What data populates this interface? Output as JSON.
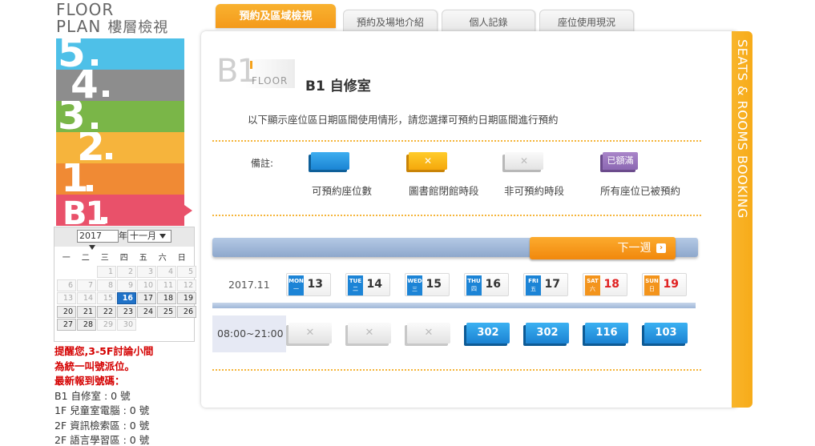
{
  "brand": {
    "line1": "FLOOR",
    "line2": "PLAN",
    "subtitle": "樓層檢視"
  },
  "floors": [
    "5",
    "4",
    "3",
    "2",
    "1",
    "B1"
  ],
  "colors": {
    "accent": "#f49a1b",
    "blue": "#1c84d6",
    "red": "#d40000"
  },
  "calendar": {
    "year": "2017",
    "month": "十一月",
    "year_suffix": "年",
    "weekdays": [
      "一",
      "二",
      "三",
      "四",
      "五",
      "六",
      "日"
    ],
    "cells": [
      "",
      "",
      "1",
      "2",
      "3",
      "4",
      "5",
      "6",
      "7",
      "8",
      "9",
      "10",
      "11",
      "12",
      "13",
      "14",
      "15",
      "16",
      "17",
      "18",
      "19",
      "20",
      "21",
      "22",
      "23",
      "24",
      "25",
      "26",
      "27",
      "28",
      "29",
      "30",
      "",
      "",
      ""
    ],
    "today": "16"
  },
  "notice": {
    "line1": "提醒您,3-5F討論小間",
    "line2": "為統一叫號派位。",
    "line3": "最新報到號碼：",
    "stats": [
      "B1 自修室 : 0 號",
      "1F 兒童室電腦 : 0 號",
      "2F 資訊檢索區 : 0 號",
      "2F 語言學習區 : 0 號"
    ]
  },
  "tabs": [
    "預約及區域檢視",
    "預約及場地介紹",
    "個人記錄",
    "座位使用現況"
  ],
  "sidebar_text": "SEATS & ROOMS BOOKING",
  "header": {
    "logo_big": "B1",
    "logo_floor": "FLOOR",
    "room": "B1 自修室"
  },
  "intro": "以下顯示座位區日期區間使用情形，請您選擇可預約日期區間進行預約",
  "legend": {
    "label": "備註:",
    "items": [
      {
        "badge": "",
        "caption": "可預約座位數"
      },
      {
        "badge": "✕",
        "caption": "圖書館閉館時段"
      },
      {
        "badge": "✕",
        "caption": "非可預約時段"
      },
      {
        "badge": "已額滿",
        "caption": "所有座位已被預約"
      }
    ]
  },
  "next_week": "下一週",
  "month_label": "2017.11",
  "days": [
    {
      "en": "MON",
      "zh": "一",
      "num": "13",
      "weekend": false
    },
    {
      "en": "TUE",
      "zh": "二",
      "num": "14",
      "weekend": false
    },
    {
      "en": "WED",
      "zh": "三",
      "num": "15",
      "weekend": false
    },
    {
      "en": "THU",
      "zh": "四",
      "num": "16",
      "weekend": false
    },
    {
      "en": "FRI",
      "zh": "五",
      "num": "17",
      "weekend": false
    },
    {
      "en": "SAT",
      "zh": "六",
      "num": "18",
      "weekend": true
    },
    {
      "en": "SUN",
      "zh": "日",
      "num": "19",
      "weekend": true
    }
  ],
  "time_range": "08:00~21:00",
  "slots": [
    {
      "status": "unavailable",
      "value": "✕"
    },
    {
      "status": "unavailable",
      "value": "✕"
    },
    {
      "status": "unavailable",
      "value": "✕"
    },
    {
      "status": "available",
      "value": "302"
    },
    {
      "status": "available",
      "value": "302"
    },
    {
      "status": "available",
      "value": "116"
    },
    {
      "status": "available",
      "value": "103"
    }
  ]
}
